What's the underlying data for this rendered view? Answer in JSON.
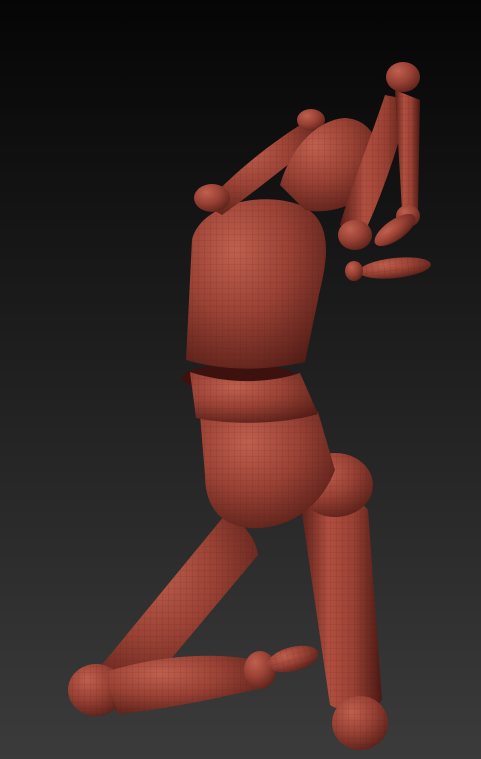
{
  "scene": {
    "subject": "mannequin-figure",
    "colors": {
      "background_top": "#050505",
      "background_bottom": "#3b3b3b",
      "material_base": "#8a3a30",
      "material_light": "#b25446",
      "material_dark": "#4a1812",
      "wire_line": "#6e2a22"
    }
  }
}
